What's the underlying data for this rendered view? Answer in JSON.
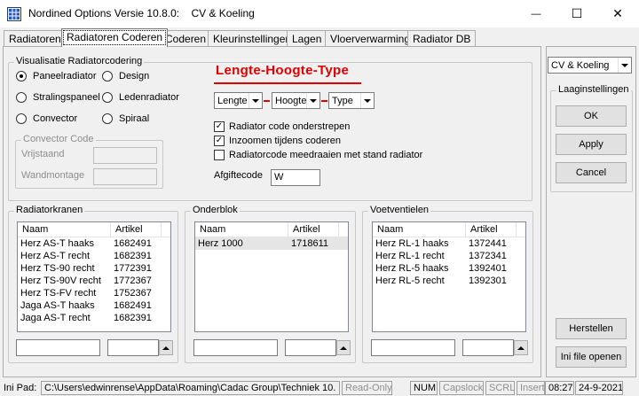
{
  "window": {
    "title": "Nordined Options Versie 10.8.0:    CV & Koeling",
    "minimize_glyph": "—",
    "maximize_glyph": "☐",
    "close_glyph": "✕"
  },
  "tabs": [
    "Radiatoren",
    "Radiatoren Coderen",
    "Coderen",
    "Kleurinstellingen",
    "Lagen",
    "Vloerverwarming",
    "Radiator DB"
  ],
  "visualisatie": {
    "title": "Visualisatie Radiatorcodering",
    "radios": {
      "paneelradiator": "Paneelradiator",
      "design": "Design",
      "stralingspaneel": "Stralingspaneel",
      "ledenradiator": "Ledenradiator",
      "convector": "Convector",
      "spiraal": "Spiraal"
    },
    "convector_code": {
      "title": "Convector Code",
      "vrijstaand": "Vrijstaand",
      "wandmontage": "Wandmontage"
    },
    "heading": "Lengte-Hoogte-Type",
    "combos": {
      "lengte": "Lengte",
      "hoogte": "Hoogte",
      "type": "Type"
    },
    "checks": {
      "onderstrepen": "Radiator code onderstrepen",
      "inzoomen": "Inzoomen tijdens coderen",
      "meedraaien": "Radiatorcode meedraaien met stand radiator"
    },
    "afgiftecode_label": "Afgiftecode",
    "afgiftecode_value": "W"
  },
  "radiatorkranen": {
    "title": "Radiatorkranen",
    "columns": [
      "Naam",
      "Artikel"
    ],
    "rows": [
      [
        "Herz AS-T haaks",
        "1682491"
      ],
      [
        "Herz AS-T recht",
        "1682391"
      ],
      [
        "Herz TS-90 recht",
        "1772391"
      ],
      [
        "Herz TS-90V recht",
        "1772367"
      ],
      [
        "Herz TS-FV recht",
        "1752367"
      ],
      [
        "Jaga AS-T haaks",
        "1682491"
      ],
      [
        "Jaga AS-T recht",
        "1682391"
      ]
    ]
  },
  "onderblok": {
    "title": "Onderblok",
    "columns": [
      "Naam",
      "Artikel"
    ],
    "rows": [
      [
        "Herz 1000",
        "1718611"
      ]
    ]
  },
  "voetventielen": {
    "title": "Voetventielen",
    "columns": [
      "Naam",
      "Artikel"
    ],
    "rows": [
      [
        "Herz RL-1 haaks",
        "1372441"
      ],
      [
        "Herz RL-1 recht",
        "1372341"
      ],
      [
        "Herz RL-5 haaks",
        "1392401"
      ],
      [
        "Herz RL-5 recht",
        "1392301"
      ]
    ]
  },
  "right": {
    "profile": "CV & Koeling",
    "group_title": "Laaginstellingen",
    "ok": "OK",
    "apply": "Apply",
    "cancel": "Cancel",
    "herstellen": "Herstellen",
    "ini_open": "Ini file openen"
  },
  "status": {
    "ini_label": "Ini Pad:",
    "ini_path": "C:\\Users\\edwinrense\\AppData\\Roaming\\Cadac Group\\Techniek 10.",
    "readonly": "Read-Only",
    "num": "NUM",
    "caps": "Capslock",
    "scrl": "SCRL",
    "insert": "Insert",
    "time": "08:27",
    "date": "24-9-2021"
  },
  "colors": {
    "accent_red": "#e00000",
    "selection": "#e5e5e5"
  }
}
